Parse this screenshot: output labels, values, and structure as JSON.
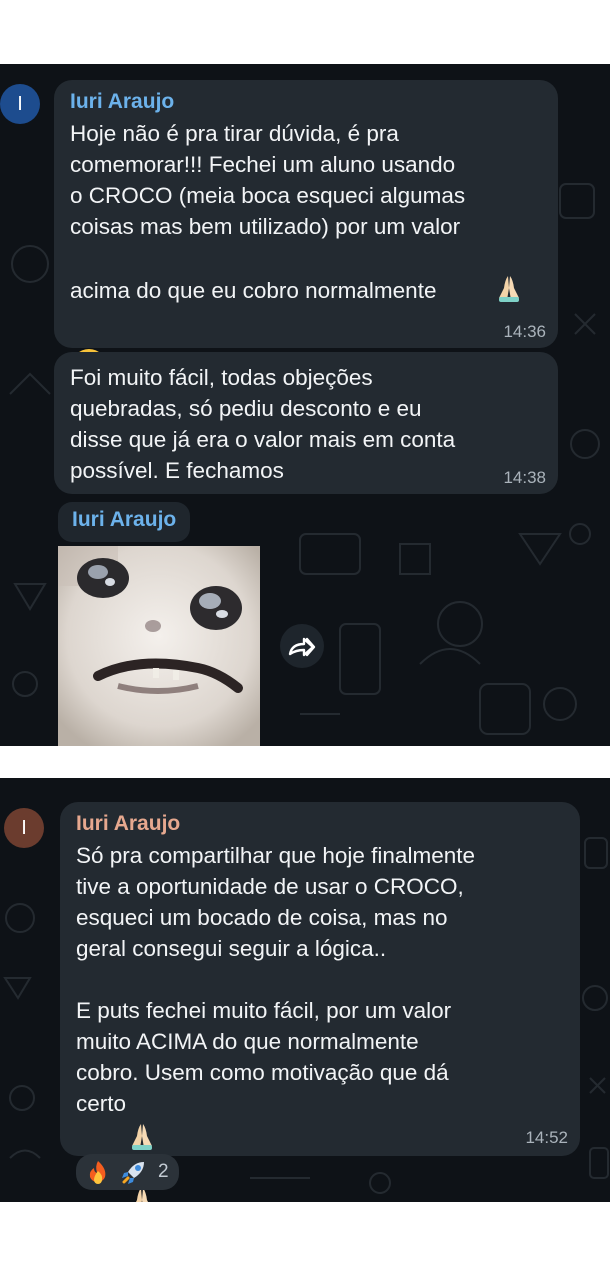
{
  "chat1": {
    "avatar_letter": "I",
    "sender": "Iuri Araujo",
    "message1_text": "Hoje não é pra tirar dúvida, é pra\ncomemorar!!! Fechei um aluno usando\no CROCO (meia boca esqueci algumas\ncoisas mas bem utilizado) por um valor\nacima do que eu cobro normalmente",
    "message1_time": "14:36",
    "message2_text": "Foi muito fácil, todas objeções\nquebradas, só pediu desconto e eu\ndisse que já era o valor mais em conta\npossível. E fechamos",
    "message2_time": "14:38",
    "sticker_sender": "Iuri Araujo",
    "forward_icon": "share-arrow-icon"
  },
  "chat2": {
    "avatar_letter": "I",
    "sender": "Iuri Araujo",
    "message_paragraph1": "Só pra compartilhar que hoje finalmente\ntive a oportunidade de usar o CROCO,\nesqueci um bocado de coisa, mas no\ngeral consegui seguir a lógica..",
    "message_paragraph2": "E puts fechei muito fácil, por um valor\nmuito ACIMA do que normalmente\ncobro. Usem como motivação que dá",
    "message_last_word": "certo",
    "message_time": "14:52",
    "reaction_count": "2",
    "reactions": [
      "fire-emoji",
      "rocket-emoji"
    ]
  },
  "colors": {
    "chat1_name": "#6cb2eb",
    "chat1_avatar": "#1d4c8e",
    "chat2_name": "#e6a88f",
    "chat2_avatar": "#6b3c2e",
    "bubble": "#232a31",
    "background": "#0e1217"
  }
}
